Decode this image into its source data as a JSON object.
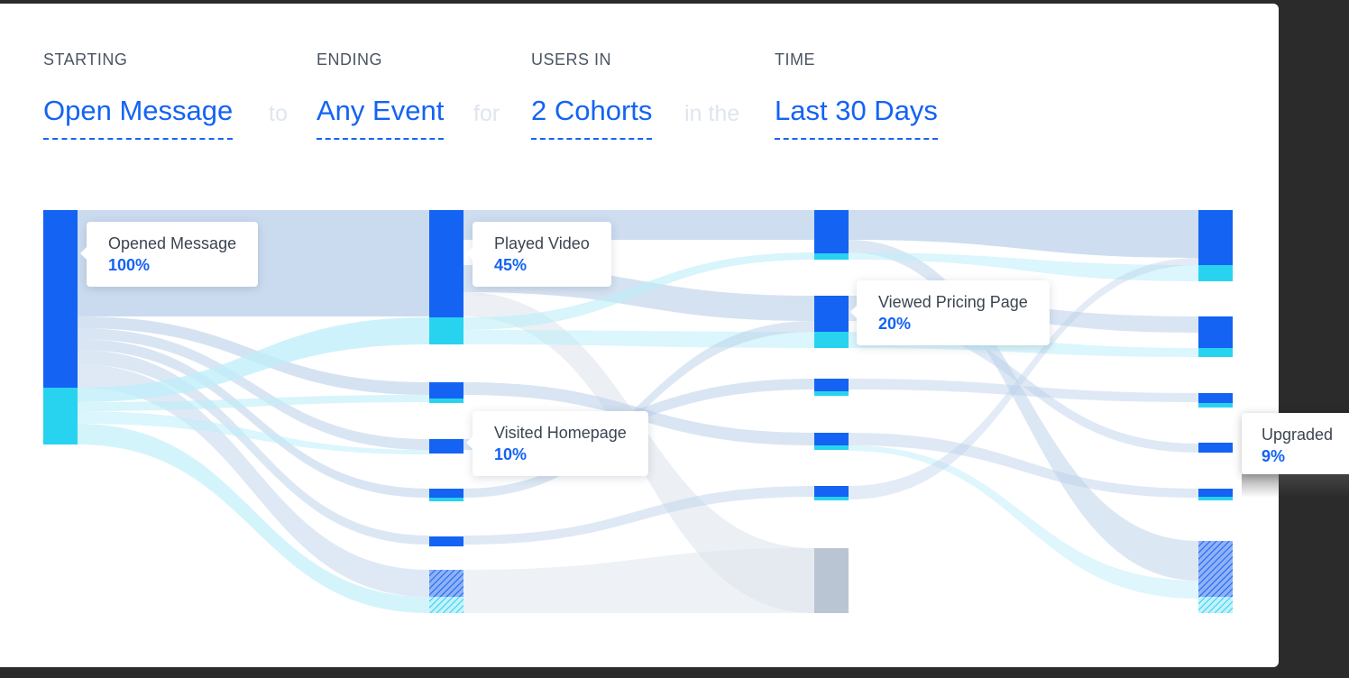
{
  "filters": {
    "starting": {
      "label": "STARTING",
      "value": "Open Message"
    },
    "ending": {
      "label": "ENDING",
      "value": "Any Event"
    },
    "users": {
      "label": "USERS IN",
      "value": "2 Cohorts"
    },
    "time": {
      "label": "TIME",
      "value": "Last 30 Days"
    },
    "connectors": [
      "to",
      "for",
      "in the"
    ]
  },
  "tooltips": {
    "opened": {
      "name": "Opened Message",
      "pct": "100%"
    },
    "played": {
      "name": "Played Video",
      "pct": "45%"
    },
    "visited": {
      "name": "Visited Homepage",
      "pct": "10%"
    },
    "pricing": {
      "name": "Viewed Pricing Page",
      "pct": "20%"
    },
    "upgraded": {
      "name": "Upgraded",
      "pct": "9%"
    }
  },
  "colors": {
    "primary": "#1463f3",
    "secondary": "#28d3ef",
    "flow_primary": "#b9cfe9",
    "flow_secondary": "#bdeef9",
    "dropoff": "#bac5d3",
    "text": "#3b4552"
  }
}
